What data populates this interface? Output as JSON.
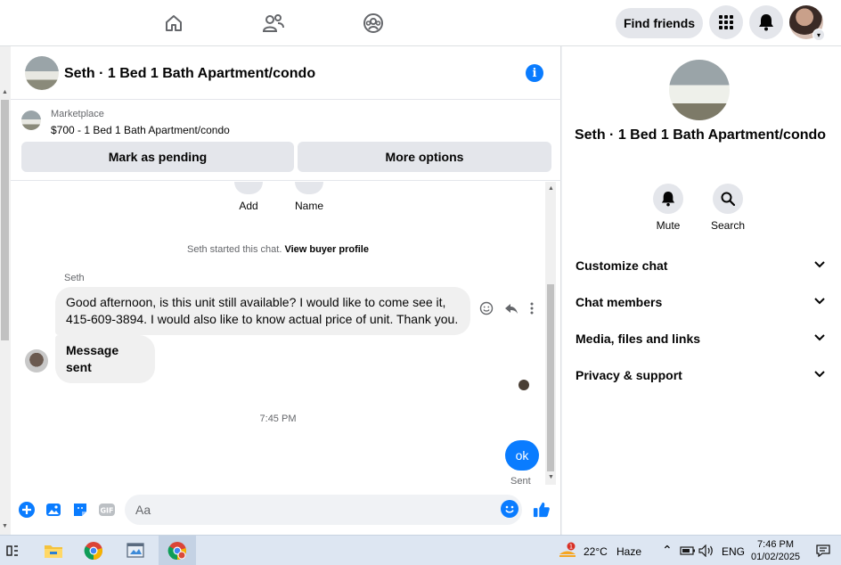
{
  "topnav": {
    "icons": [
      "home-icon",
      "friends-icon",
      "groups-icon"
    ],
    "find_friends": "Find friends",
    "menu_icon": "grid-menu-icon",
    "notifications_icon": "bell-icon",
    "profile_icon": "profile-avatar"
  },
  "chat": {
    "title": "Seth · 1 Bed 1 Bath Apartment/condo",
    "info_icon": "i",
    "marketplace": {
      "label": "Marketplace",
      "listing": "$700 - 1 Bed 1 Bath Apartment/condo",
      "mark_pending": "Mark as pending",
      "more_options": "More options"
    },
    "actions": [
      {
        "label": "Add"
      },
      {
        "label": "Name"
      }
    ],
    "system_prefix": "Seth started this chat.",
    "system_link": "View buyer profile",
    "sender_name": "Seth",
    "message_1": "Good afternoon, is this unit still available? I would like to come see it, 415-609-3894. I would also like to know actual price of unit. Thank you.",
    "message_2": "Message sent",
    "time": "7:45 PM",
    "own_message": "ok",
    "own_status": "Sent",
    "composer_placeholder": "Aa"
  },
  "right_panel": {
    "title": "Seth · 1 Bed 1 Bath Apartment/condo",
    "mute": "Mute",
    "search": "Search",
    "sections": [
      "Customize chat",
      "Chat members",
      "Media, files and links",
      "Privacy & support"
    ]
  },
  "taskbar": {
    "weather_temp": "22°C",
    "weather_desc": "Haze",
    "lang": "ENG",
    "time": "7:46 PM",
    "date": "01/02/2025",
    "weather_badge": "1"
  },
  "colors": {
    "accent": "#0a7cff",
    "button_gray": "#e4e6eb",
    "bubble_gray": "#f0f0f0"
  }
}
